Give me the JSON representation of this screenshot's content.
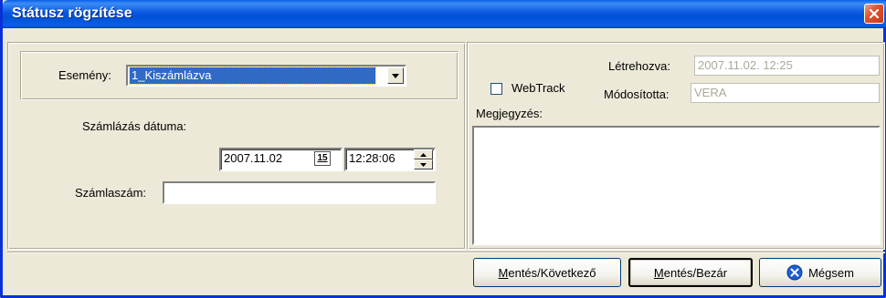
{
  "window": {
    "title": "Státusz rögzítése"
  },
  "left": {
    "event_label": "Esemény:",
    "event_value": "1_Kiszámlázva",
    "billing_date_label": "Számlázás dátuma:",
    "date_value": "2007.11.02",
    "calendar_glyph": "15",
    "time_value": "12:28:06",
    "invoice_number_label": "Számlaszám:",
    "invoice_number_value": ""
  },
  "right": {
    "created_label": "Létrehozva:",
    "created_value": "2007.11.02. 12:25",
    "modified_label": "Módosította:",
    "modified_value": "VERA",
    "webtrack_label": "WebTrack",
    "webtrack_checked": false,
    "notes_label": "Megjegyzés:",
    "notes_value": ""
  },
  "buttons": {
    "save_next": {
      "mnemonic": "M",
      "rest": "entés/Következő"
    },
    "save_close": {
      "mnemonic": "M",
      "rest": "entés/Bezár"
    },
    "cancel": "Mégsem"
  },
  "colors": {
    "title_blue": "#0a58e0",
    "selection": "#316ac5",
    "close_red": "#e2532f"
  }
}
